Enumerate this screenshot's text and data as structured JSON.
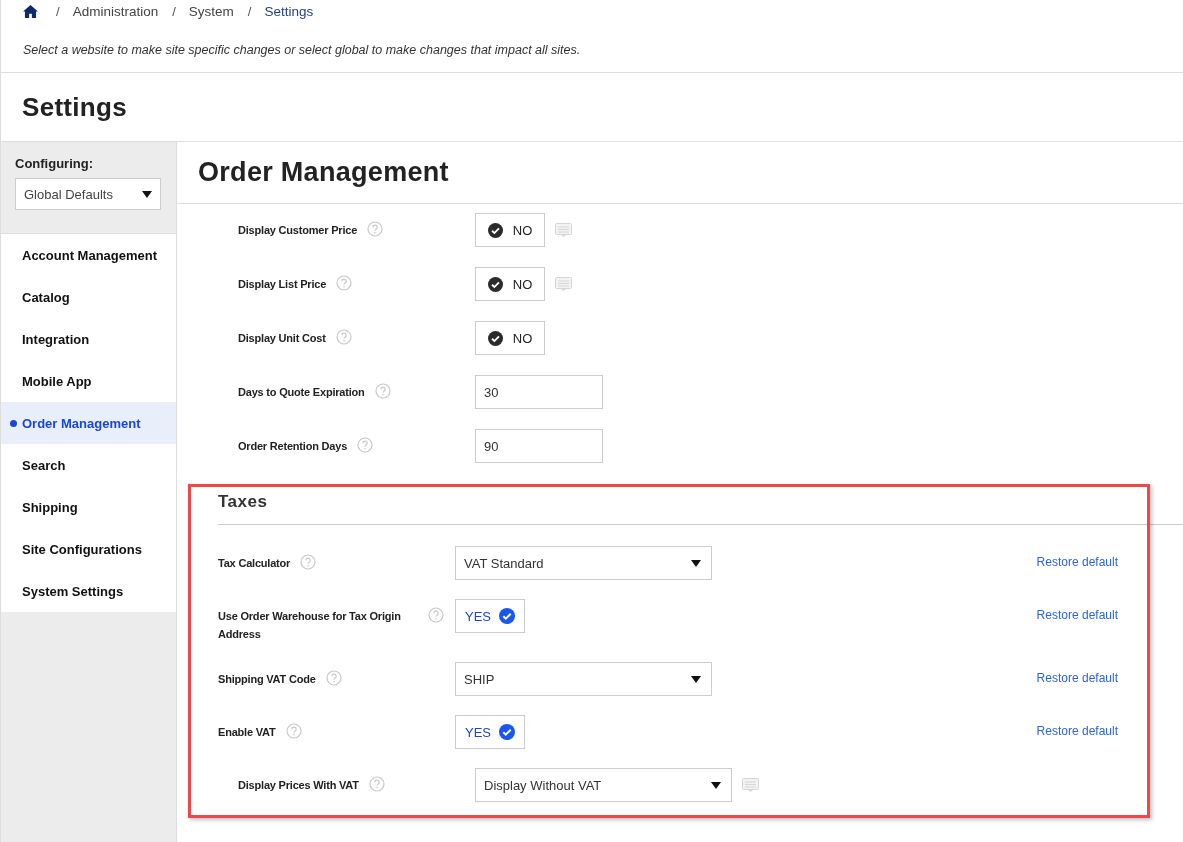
{
  "breadcrumb": [
    {
      "separator": "/",
      "label": "Administration",
      "selected": false
    },
    {
      "separator": "/",
      "label": "System",
      "selected": false
    },
    {
      "separator": "/",
      "label": "Settings",
      "selected": true
    }
  ],
  "description": "Select a website to make site specific changes or select global to make changes that impact all sites.",
  "page_title": "Settings",
  "sidebar": {
    "configuring_label": "Configuring:",
    "site_select": {
      "value": "Global Defaults"
    },
    "items": [
      {
        "label": "Account Management",
        "selected": false
      },
      {
        "label": "Catalog",
        "selected": false
      },
      {
        "label": "Integration",
        "selected": false
      },
      {
        "label": "Mobile App",
        "selected": false
      },
      {
        "label": "Order Management",
        "selected": true
      },
      {
        "label": "Search",
        "selected": false
      },
      {
        "label": "Shipping",
        "selected": false
      },
      {
        "label": "Site Configurations",
        "selected": false
      },
      {
        "label": "System Settings",
        "selected": false
      }
    ]
  },
  "section_title": "Order Management",
  "settings": [
    {
      "label": "Display Customer Price",
      "kind": "toggle",
      "on": false,
      "value": "NO",
      "note": true
    },
    {
      "label": "Display List Price",
      "kind": "toggle",
      "on": false,
      "value": "NO",
      "note": true
    },
    {
      "label": "Display Unit Cost",
      "kind": "toggle",
      "on": false,
      "value": "NO",
      "note": false
    },
    {
      "label": "Days to Quote Expiration",
      "kind": "number",
      "value": "30",
      "note": false
    },
    {
      "label": "Order Retention Days",
      "kind": "number",
      "value": "90",
      "note": false
    }
  ],
  "taxes": {
    "title": "Taxes",
    "settings": [
      {
        "label": "Tax Calculator",
        "kind": "select",
        "value": "VAT Standard",
        "note": false,
        "restore": "Restore default"
      },
      {
        "label": "Use Order Warehouse for Tax Origin Address",
        "kind": "toggle",
        "on": true,
        "value": "YES",
        "note": false,
        "restore": "Restore default"
      },
      {
        "label": "Shipping VAT Code",
        "kind": "select",
        "value": "SHIP",
        "note": false,
        "restore": "Restore default"
      },
      {
        "label": "Enable VAT",
        "kind": "toggle",
        "on": true,
        "value": "YES",
        "note": false,
        "restore": "Restore default",
        "children": [
          {
            "label": "Display Prices With VAT",
            "kind": "select",
            "value": "Display Without VAT",
            "note": true
          }
        ]
      }
    ]
  }
}
